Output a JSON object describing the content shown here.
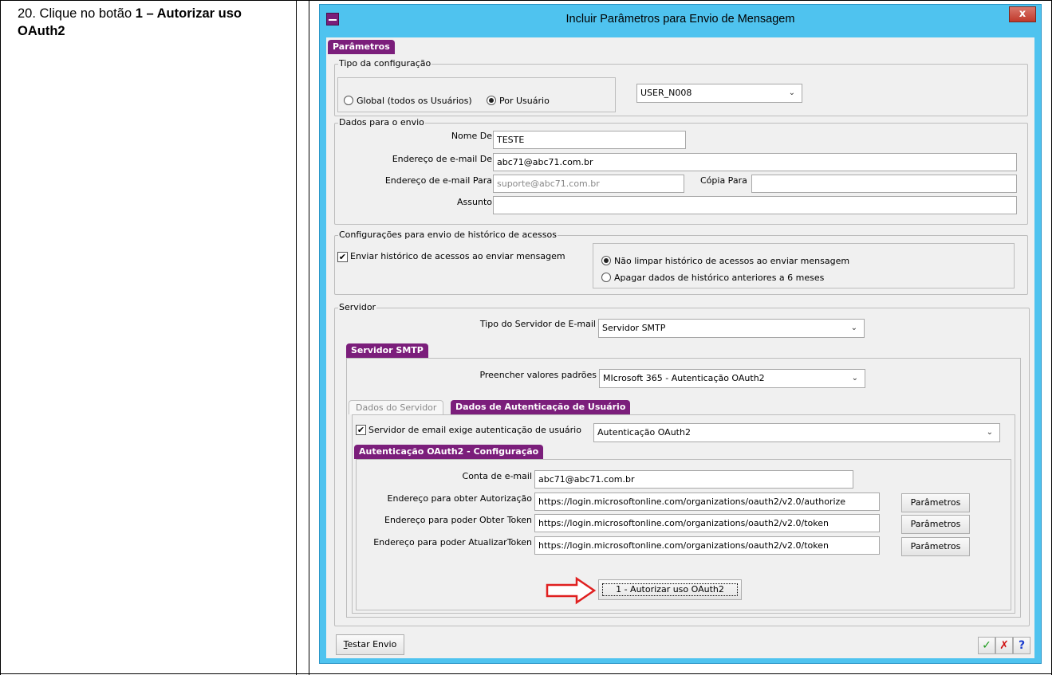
{
  "instruction": {
    "number": "20.",
    "text_prefix": "Clique no botão ",
    "text_bold": "1 – Autorizar uso OAuth2"
  },
  "window": {
    "title": "Incluir Parâmetros para Envio de Mensagem",
    "close_label": "x"
  },
  "tabs": {
    "main": "Parâmetros",
    "smtp": "Servidor SMTP",
    "server_data": "Dados do Servidor",
    "auth_data": "Dados de Autenticação de Usuário",
    "oauth_config": "Autenticação OAuth2 - Configuração"
  },
  "config_type": {
    "group_label": "Tipo da configuração",
    "radio_global": "Global (todos os Usuários)",
    "radio_user": "Por Usuário",
    "selected": "Por Usuário",
    "user_select_value": "USER_N008"
  },
  "send_data": {
    "group_label": "Dados para o envio",
    "name_from_label": "Nome De",
    "name_from_value": "TESTE",
    "email_from_label": "Endereço de e-mail De",
    "email_from_value": "abc71@abc71.com.br",
    "email_to_label": "Endereço de e-mail Para",
    "email_to_value": "suporte@abc71.com.br",
    "cc_label": "Cópia Para",
    "cc_value": "",
    "subject_label": "Assunto",
    "subject_value": ""
  },
  "history": {
    "group_label": "Configurações para envio de histórico de acessos",
    "send_history_label": "Enviar histórico de acessos ao enviar mensagem",
    "send_history_checked": true,
    "radio_keep": "Não limpar histórico de acessos ao enviar mensagem",
    "radio_delete": "Apagar dados de histórico anteriores a 6 meses",
    "selected": "Não limpar histórico de acessos ao enviar mensagem"
  },
  "server": {
    "group_label": "Servidor",
    "type_label": "Tipo do Servidor de E-mail",
    "type_value": "Servidor SMTP",
    "defaults_label": "Preencher valores padrões",
    "defaults_value": "MIcrosoft 365 - Autenticação OAuth2",
    "requires_auth_label": "Servidor de email exige autenticação de usuário",
    "requires_auth_checked": true,
    "auth_type_value": "Autenticação OAuth2"
  },
  "oauth": {
    "account_label": "Conta de e-mail",
    "account_value": "abc71@abc71.com.br",
    "authorize_label": "Endereço para obter Autorização",
    "authorize_value": "https://login.microsoftonline.com/organizations/oauth2/v2.0/authorize",
    "token_label": "Endereço para poder Obter Token",
    "token_value": "https://login.microsoftonline.com/organizations/oauth2/v2.0/token",
    "refresh_label": "Endereço para poder AtualizarToken",
    "refresh_value": "https://login.microsoftonline.com/organizations/oauth2/v2.0/token",
    "params_button": "Parâmetros",
    "authorize_button": "1 - Autorizar uso OAuth2"
  },
  "footer": {
    "test_button_underlined": "T",
    "test_button_rest": "estar Envio",
    "ok_icon": "✓",
    "cancel_icon": "✗",
    "help_icon": "?"
  },
  "colors": {
    "titlebar": "#4fc3ef",
    "tab_purple": "#7b1e7b",
    "arrow_red": "#e02020",
    "ok_green": "#1a9a1a",
    "cancel_red": "#d01010",
    "help_blue": "#1a3ccf"
  }
}
